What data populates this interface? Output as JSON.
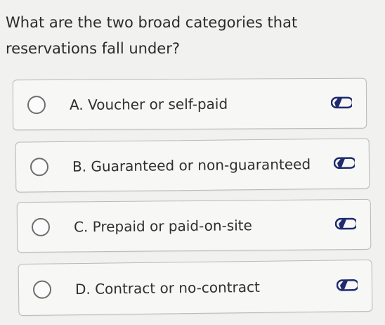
{
  "question": {
    "text": "What are the two broad categories that reservations fall under?"
  },
  "options": [
    {
      "label": "A. Voucher or self-paid"
    },
    {
      "label": "B. Guaranteed or non-guaranteed"
    },
    {
      "label": "C. Prepaid or paid-on-site"
    },
    {
      "label": "D. Contract or no-contract"
    }
  ],
  "icons": {
    "radio": "radio-unchecked-icon",
    "answer_tag": "eliminate-answer-icon"
  },
  "colors": {
    "pill": "#1f2a6e"
  }
}
